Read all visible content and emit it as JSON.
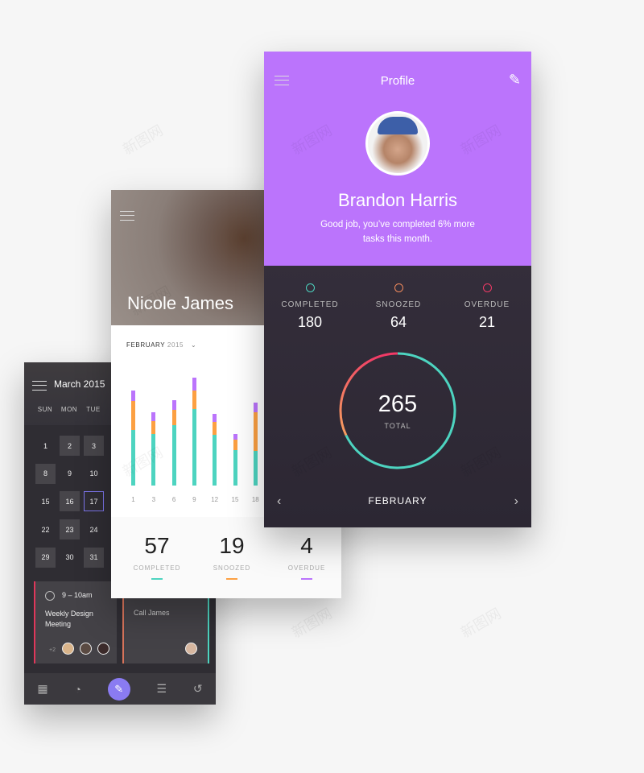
{
  "calendar": {
    "title": "March 2015",
    "weekdays": [
      "SUN",
      "MON",
      "TUE"
    ],
    "days": [
      [
        "1",
        "2",
        "3"
      ],
      [
        "8",
        "9",
        "10"
      ],
      [
        "15",
        "16",
        "17"
      ],
      [
        "22",
        "23",
        "24"
      ],
      [
        "29",
        "30",
        "31"
      ]
    ],
    "selected_day": "17",
    "events": [
      {
        "time": "9 – 10am",
        "title": "Weekly Design Meeting",
        "extra_attendees": "+2",
        "accent": "#e0375a"
      },
      {
        "title": "Call James",
        "accent": "#d6735a"
      }
    ],
    "nav_icons": [
      "calendar-icon",
      "pie-chart-icon",
      "new-task-icon",
      "list-icon",
      "history-icon"
    ]
  },
  "stats": {
    "user_name": "Nicole James",
    "month": "FEBRUARY",
    "year": "2015",
    "summary": [
      {
        "value": "57",
        "label": "COMPLETED",
        "color": "#4dd4c0"
      },
      {
        "value": "19",
        "label": "SNOOZED",
        "color": "#fca042"
      },
      {
        "value": "4",
        "label": "OVERDUE",
        "color": "#bb74fc"
      }
    ]
  },
  "chart_data": {
    "type": "bar",
    "stacked": true,
    "categories": [
      "1",
      "3",
      "6",
      "9",
      "12",
      "15",
      "18"
    ],
    "series": [
      {
        "values": [
          69,
          64,
          75,
          95,
          63,
          44,
          43
        ],
        "color": "#4dd4c0"
      },
      {
        "values": [
          36,
          16,
          19,
          23,
          16,
          13,
          48
        ],
        "color": "#fca042"
      },
      {
        "values": [
          13,
          11,
          12,
          16,
          10,
          7,
          12
        ],
        "color": "#bb74fc"
      }
    ]
  },
  "profile": {
    "title": "Profile",
    "name": "Brandon Harris",
    "message": "Good job, you’ve completed 6% more tasks this month.",
    "stats": [
      {
        "label": "COMPLETED",
        "value": "180",
        "color": "#4dd4c0"
      },
      {
        "label": "SNOOZED",
        "value": "64",
        "color": "#f08a5d"
      },
      {
        "label": "OVERDUE",
        "value": "21",
        "color": "#f03a66"
      }
    ],
    "total": "265",
    "total_label": "TOTAL",
    "month": "FEBRUARY",
    "accent": "#bb74fc"
  },
  "watermark": "新图网"
}
